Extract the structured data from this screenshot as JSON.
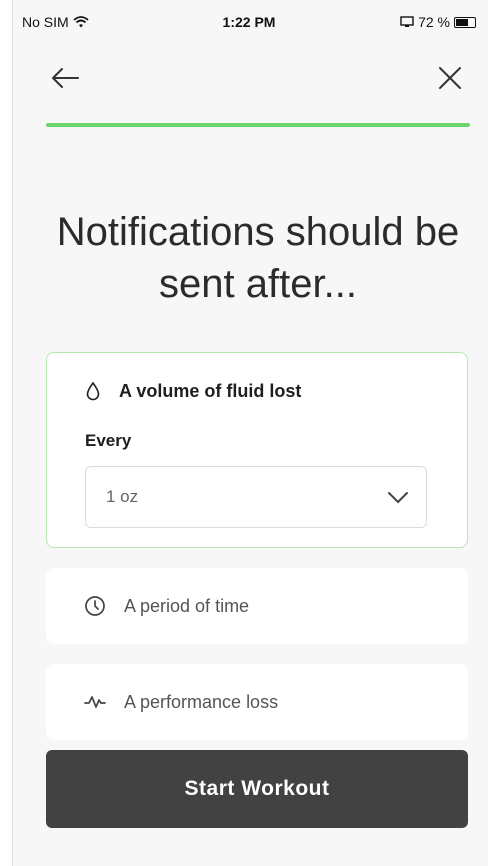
{
  "status_bar": {
    "carrier": "No SIM",
    "time": "1:22 PM",
    "battery_text": "72 %",
    "battery_level": 0.72
  },
  "nav": {
    "back_icon": "arrow-left-icon",
    "close_icon": "close-icon"
  },
  "progress": {
    "value": 1.0,
    "color": "#6dd66b"
  },
  "heading": "Notifications should be sent after...",
  "options": {
    "fluid": {
      "icon": "droplet-icon",
      "label": "A volume of fluid lost",
      "selected": true,
      "every_label": "Every",
      "select_value": "1 oz"
    },
    "time": {
      "icon": "clock-icon",
      "label": "A period of time"
    },
    "performance": {
      "icon": "pulse-icon",
      "label": "A performance loss"
    }
  },
  "start_button": {
    "label": "Start Workout",
    "background": "#424242"
  }
}
